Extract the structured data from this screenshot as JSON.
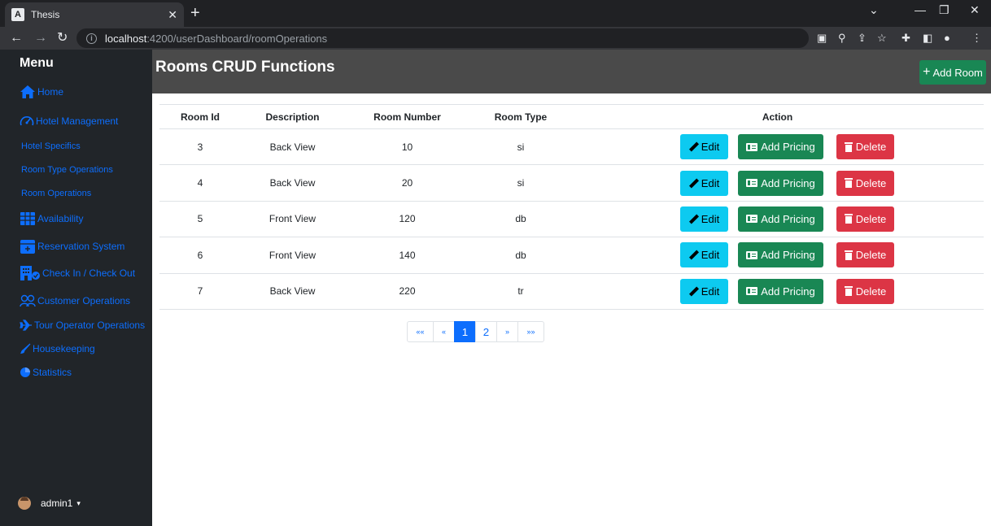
{
  "browser": {
    "tab_title": "Thesis",
    "tab_favicon_letter": "A",
    "url_host": "localhost",
    "url_path": ":4200/userDashboard/roomOperations"
  },
  "sidebar": {
    "title": "Menu",
    "items": [
      {
        "label": "Home",
        "icon": "home-icon"
      },
      {
        "label": "Hotel Management",
        "icon": "dashboard-gauge-icon"
      },
      {
        "label": "Hotel Specifics",
        "icon": ""
      },
      {
        "label": "Room Type Operations",
        "icon": ""
      },
      {
        "label": "Room Operations",
        "icon": ""
      },
      {
        "label": "Availability",
        "icon": "grid-table-icon"
      },
      {
        "label": "Reservation System",
        "icon": "calendar-plus-icon"
      },
      {
        "label": "Check In / Check Out",
        "icon": "building-check-icon"
      },
      {
        "label": "Customer Operations",
        "icon": "people-icon"
      },
      {
        "label": "Tour Operator Operations",
        "icon": "airplane-icon"
      },
      {
        "label": "Housekeeping",
        "icon": "brush-icon"
      },
      {
        "label": "Statistics",
        "icon": "pie-chart-icon"
      }
    ],
    "user": {
      "name": "admin1",
      "caret": "▾"
    }
  },
  "header": {
    "title": "Rooms CRUD Functions",
    "add_button": "Add Room"
  },
  "table": {
    "columns": [
      "Room Id",
      "Description",
      "Room Number",
      "Room Type",
      "Action"
    ],
    "rows": [
      {
        "id": "3",
        "description": "Back View",
        "number": "10",
        "type": "si"
      },
      {
        "id": "4",
        "description": "Back View",
        "number": "20",
        "type": "si"
      },
      {
        "id": "5",
        "description": "Front View",
        "number": "120",
        "type": "db"
      },
      {
        "id": "6",
        "description": "Front View",
        "number": "140",
        "type": "db"
      },
      {
        "id": "7",
        "description": "Back View",
        "number": "220",
        "type": "tr"
      }
    ],
    "actions": {
      "edit": "Edit",
      "pricing": "Add Pricing",
      "delete": "Delete"
    }
  },
  "pagination": {
    "first": "««",
    "prev": "«",
    "pages": [
      "1",
      "2"
    ],
    "active_page": "1",
    "next": "»",
    "last": "»»"
  },
  "colors": {
    "sidebar_bg": "#212529",
    "header_bg": "#4a4a4a",
    "link_blue": "#0d6efd",
    "success": "#198754",
    "info": "#0dcaf0",
    "danger": "#dc3545"
  }
}
